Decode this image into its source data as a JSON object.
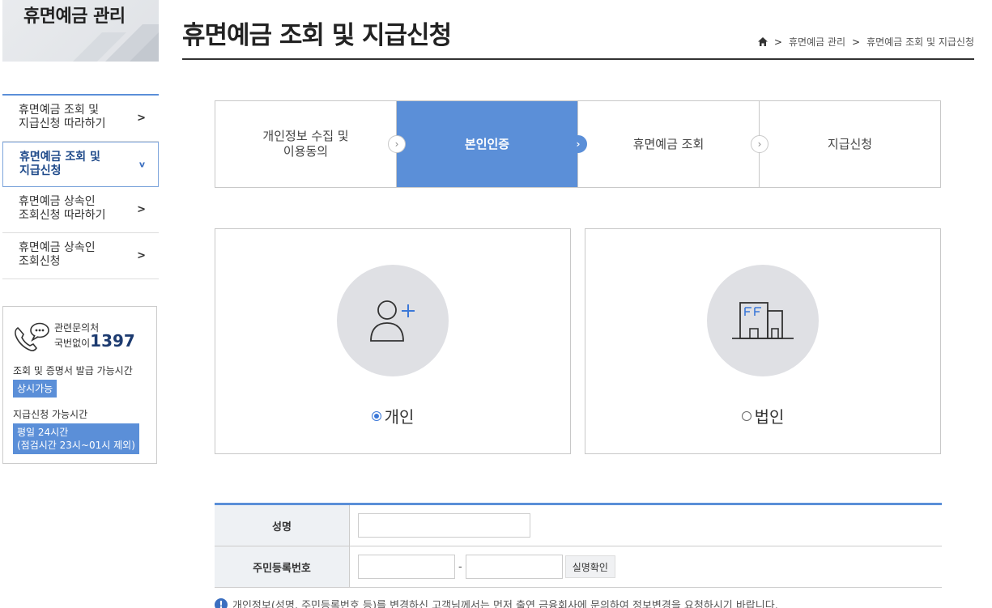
{
  "sidebar": {
    "banner_title": "휴면예금 관리",
    "menu": [
      {
        "label_line1": "휴면예금 조회 및",
        "label_line2": "지급신청 따라하기",
        "arrow": ">"
      },
      {
        "label_line1": "휴면예금 조회 및",
        "label_line2": "지급신청",
        "arrow": "v"
      },
      {
        "label_line1": "휴면예금 상속인",
        "label_line2": "조회신청 따라하기",
        "arrow": ">"
      },
      {
        "label_line1": "휴면예금 상속인",
        "label_line2": "조회신청",
        "arrow": ">"
      }
    ],
    "contact": {
      "label_line1": "관련문의처",
      "label_line2": "국번없이",
      "phone": "1397",
      "inquiry_hours_label": "조회 및 증명서 발급 가능시간",
      "inquiry_hours_value": "상시가능",
      "payment_hours_label": "지급신청 가능시간",
      "payment_hours_line1": "평일 24시간",
      "payment_hours_line2": "(점검시간 23시~01시 제외)"
    }
  },
  "header": {
    "title": "휴면예금 조회 및 지급신청",
    "breadcrumb": [
      ">",
      "휴면예금 관리",
      ">",
      "휴면예금 조회 및 지급신청"
    ]
  },
  "steps": [
    {
      "line1": "개인정보 수집 및",
      "line2": "이용동의"
    },
    {
      "line1": "본인인증",
      "line2": ""
    },
    {
      "line1": "휴면예금 조회",
      "line2": ""
    },
    {
      "line1": "지급신청",
      "line2": ""
    }
  ],
  "types": {
    "personal": {
      "label": "개인",
      "selected": true
    },
    "corporate": {
      "label": "법인",
      "selected": false
    }
  },
  "form": {
    "name_label": "성명",
    "name_value": "",
    "rrn_label": "주민등록번호",
    "rrn_front": "",
    "rrn_back": "",
    "rrn_separator": "-",
    "verify_button": "실명확인"
  },
  "notice": "개인정보(성명, 주민등록번호 등)를 변경하신 고객님께서는 먼저 출연 금융회사에 문의하여 정보변경을 요청하시기 바랍니다.",
  "colors": {
    "accent": "#5b8fd8",
    "title_dark": "#1d3b70"
  }
}
